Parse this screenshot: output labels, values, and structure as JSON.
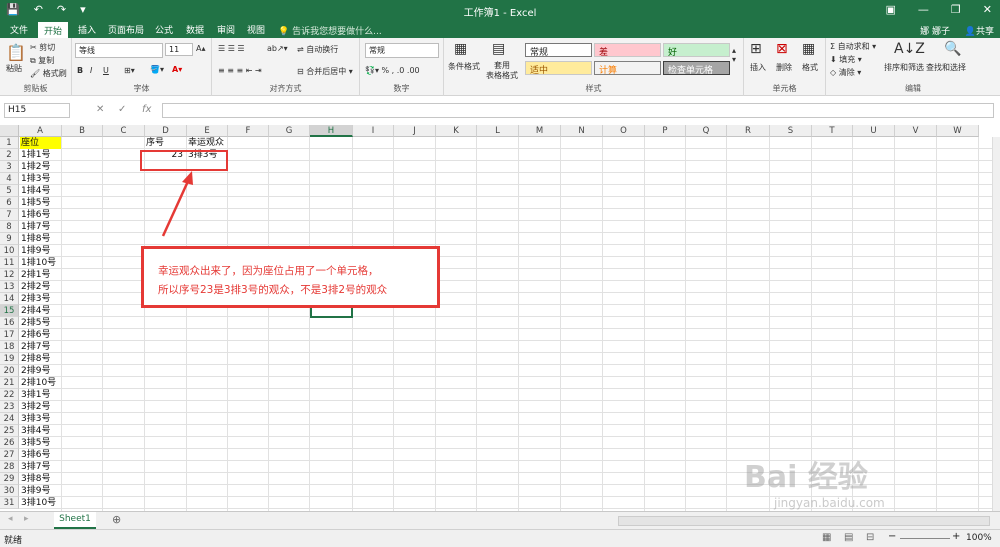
{
  "window": {
    "title": "工作簿1 - Excel",
    "user": "娜 娜子",
    "share": "共享"
  },
  "tabs": [
    "文件",
    "开始",
    "插入",
    "页面布局",
    "公式",
    "数据",
    "审阅",
    "视图"
  ],
  "active_tab": "开始",
  "tell_me": "告诉我您想要做什么...",
  "ribbon": {
    "clipboard": {
      "paste": "粘贴",
      "cut": "剪切",
      "copy": "复制",
      "format_painter": "格式刷",
      "label": "剪贴板"
    },
    "font": {
      "name": "等线",
      "size": "11",
      "bold": "B",
      "italic": "I",
      "underline": "U",
      "label": "字体"
    },
    "alignment": {
      "wrap": "自动换行",
      "merge": "合并后居中",
      "label": "对齐方式"
    },
    "number": {
      "format": "常规",
      "label": "数字"
    },
    "styles": {
      "cond_format": "条件格式",
      "table_format": "套用\n表格格式",
      "cells": [
        "常规",
        "差",
        "好",
        "适中",
        "计算",
        "检查单元格"
      ],
      "label": "样式"
    },
    "cells": {
      "insert": "插入",
      "delete": "删除",
      "format": "格式",
      "label": "单元格"
    },
    "editing": {
      "autosum": "自动求和",
      "fill": "填充",
      "clear": "清除",
      "sort": "排序和筛选",
      "find": "查找和选择",
      "label": "编辑"
    }
  },
  "namebox": "H15",
  "formula_icons": {
    "cancel": "✕",
    "enter": "✓",
    "fx": "fx"
  },
  "columns": [
    "A",
    "B",
    "C",
    "D",
    "E",
    "F",
    "G",
    "H",
    "I",
    "J",
    "K",
    "L",
    "M",
    "N",
    "O",
    "P",
    "Q",
    "R",
    "S",
    "T",
    "U",
    "V",
    "W"
  ],
  "rows": [
    "1",
    "2",
    "3",
    "4",
    "5",
    "6",
    "7",
    "8",
    "9",
    "10",
    "11",
    "12",
    "13",
    "14",
    "15",
    "16",
    "17",
    "18",
    "19",
    "20",
    "21",
    "22",
    "23",
    "24",
    "25",
    "26",
    "27",
    "28",
    "29",
    "30",
    "31"
  ],
  "colA": [
    "座位",
    "1排1号",
    "1排2号",
    "1排3号",
    "1排4号",
    "1排5号",
    "1排6号",
    "1排7号",
    "1排8号",
    "1排9号",
    "1排10号",
    "2排1号",
    "2排2号",
    "2排3号",
    "2排4号",
    "2排5号",
    "2排6号",
    "2排7号",
    "2排8号",
    "2排9号",
    "2排10号",
    "3排1号",
    "3排2号",
    "3排3号",
    "3排4号",
    "3排5号",
    "3排6号",
    "3排7号",
    "3排8号",
    "3排9号",
    "3排10号"
  ],
  "d1": "序号",
  "e1": "幸运观众",
  "d2": "23",
  "e2": "3排3号",
  "callout": {
    "line1": "幸运观众出来了，因为座位占用了一个单元格，",
    "line2": "所以序号23是3排3号的观众，不是3排2号的观众"
  },
  "sheet_tab": "Sheet1",
  "status": {
    "ready": "就绪",
    "zoom": "100%"
  },
  "watermark": {
    "brand": "Bai 经验",
    "url": "jingyan.baidu.com"
  },
  "colors": {
    "excel_green": "#217346",
    "highlight": "#ffff00",
    "annotation_red": "#e53935"
  }
}
